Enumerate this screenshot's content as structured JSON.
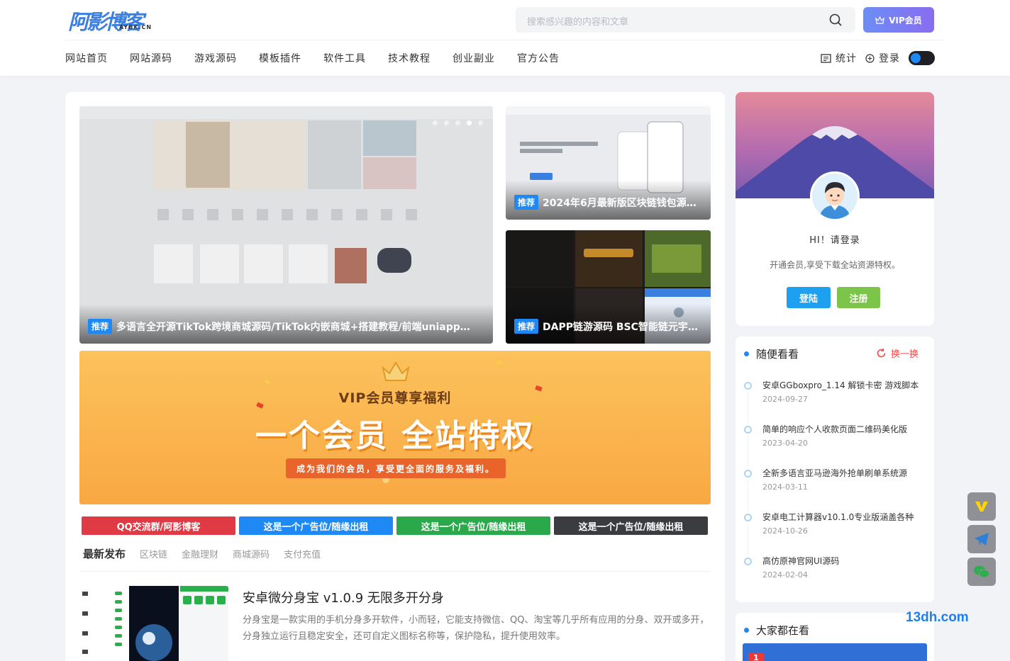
{
  "header": {
    "logo_main": "阿影博客",
    "logo_sub": "AYBK.CN",
    "search_placeholder": "搜索感兴趣的内容和文章",
    "vip_label": "VIP会员",
    "nav": [
      "网站首页",
      "网站源码",
      "游戏源码",
      "模板插件",
      "软件工具",
      "技术教程",
      "创业副业",
      "官方公告"
    ],
    "stats_label": "统计",
    "login_label": "登录"
  },
  "slides": {
    "main": {
      "tag": "推荐",
      "title": "多语言全开源TikTok跨境商城源码/TikTok内嵌商城+搭建教程/前端uniapp+..."
    },
    "side1": {
      "tag": "推荐",
      "title": "2024年6月最新版区块链钱包源码/..."
    },
    "side2": {
      "tag": "推荐",
      "title": "DAPP链游源码 BSC智能链元宇宙..."
    }
  },
  "vip_banner": {
    "heading": "VIP会员尊享福利",
    "slogan": "一个会员 全站特权",
    "sub": "成为我们的会员，享受更全面的服务及福利。"
  },
  "ads": [
    {
      "label": "QQ交流群/阿影博客",
      "color": "#e03a45"
    },
    {
      "label": "这是一个广告位/随缘出租",
      "color": "#1e88f5"
    },
    {
      "label": "这是一个广告位/随缘出租",
      "color": "#2aa84a"
    },
    {
      "label": "这是一个广告位/随缘出租",
      "color": "#3a3c40"
    }
  ],
  "tabs": [
    "最新发布",
    "区块链",
    "金融理财",
    "商城源码",
    "支付充值"
  ],
  "post": {
    "title": "安卓微分身宝 v1.0.9 无限多开分身",
    "desc": "分身宝是一款实用的手机分身多开软件，小而轻，它能支持微信、QQ、淘宝等几乎所有应用的分身、双开或多开，分身独立运行且稳定安全，还可自定义图标名称等，保护隐私，提升使用效率。"
  },
  "profile": {
    "greeting": "HI！请登录",
    "vip_text": "开通会员,享受下载全站资源特权。",
    "login_btn": "登陆",
    "register_btn": "注册"
  },
  "random": {
    "title": "随便看看",
    "refresh": "换一换",
    "items": [
      {
        "title": "安卓GGboxpro_1.14 解锁卡密 游戏脚本",
        "date": "2024-09-27"
      },
      {
        "title": "简单的响应个人收款页面二维码美化版",
        "date": "2023-04-20"
      },
      {
        "title": "全新多语言亚马逊海外抢单刷单系统源",
        "date": "2024-03-11"
      },
      {
        "title": "安卓电工计算器v10.1.0专业版涵盖各种",
        "date": "2024-10-26"
      },
      {
        "title": "高仿原神官网UI源码",
        "date": "2024-02-04"
      }
    ]
  },
  "popular": {
    "title": "大家都在看",
    "first_rank": "1"
  },
  "watermark": "13dh.com"
}
